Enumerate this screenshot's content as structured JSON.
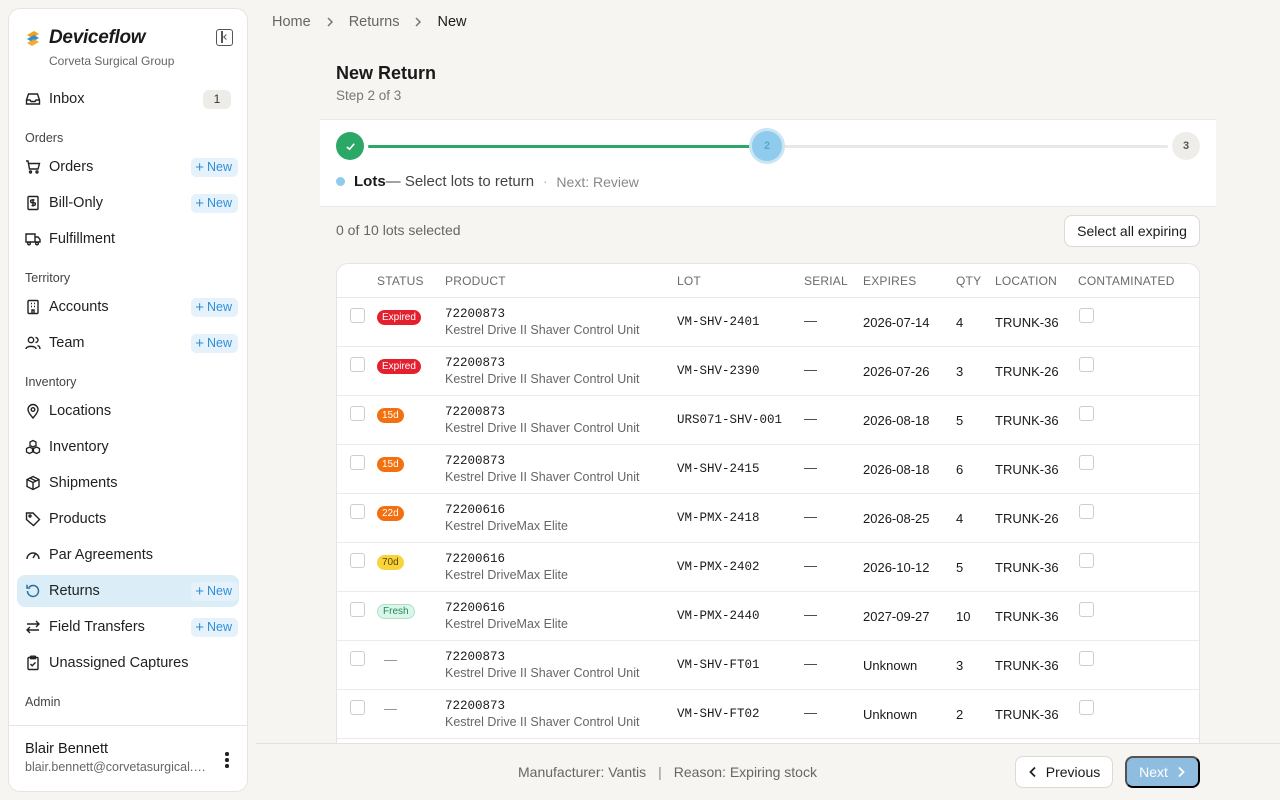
{
  "brand": {
    "name": "Deviceflow",
    "org": "Corveta Surgical Group"
  },
  "sidebar": {
    "inbox": {
      "label": "Inbox",
      "count": "1"
    },
    "sections": {
      "orders": "Orders",
      "territory": "Territory",
      "inventory": "Inventory",
      "admin": "Admin"
    },
    "items": {
      "orders": "Orders",
      "bill_only": "Bill-Only",
      "fulfillment": "Fulfillment",
      "accounts": "Accounts",
      "team": "Team",
      "locations": "Locations",
      "inventory": "Inventory",
      "shipments": "Shipments",
      "products": "Products",
      "par_agreements": "Par Agreements",
      "returns": "Returns",
      "field_transfers": "Field Transfers",
      "unassigned_captures": "Unassigned Captures"
    },
    "new_label": "New",
    "user": {
      "name": "Blair Bennett",
      "email": "blair.bennett@corvetasurgical.com"
    }
  },
  "breadcrumb": {
    "home": "Home",
    "returns": "Returns",
    "current": "New"
  },
  "header": {
    "title": "New Return",
    "subtitle": "Step 2 of 3"
  },
  "stepper": {
    "progress_fraction": 0.5,
    "steps": [
      "1",
      "2",
      "3"
    ],
    "current_label": "Lots",
    "current_desc": "— Select lots to return",
    "separator": "·",
    "next": "Next: Review"
  },
  "selection": {
    "count_text": "0 of 10 lots selected",
    "select_all_label": "Select all expiring"
  },
  "table": {
    "columns": {
      "status": "STATUS",
      "product": "PRODUCT",
      "lot": "LOT",
      "serial": "SERIAL",
      "expires": "EXPIRES",
      "qty": "QTY",
      "location": "LOCATION",
      "contaminated": "CONTAMINATED"
    },
    "rows": [
      {
        "status": "Expired",
        "status_kind": "expired",
        "code": "72200873",
        "name": "Kestrel Drive II Shaver Control Unit",
        "lot": "VM-SHV-2401",
        "serial": "—",
        "expires": "2026-07-14",
        "qty": "4",
        "location": "TRUNK-36"
      },
      {
        "status": "Expired",
        "status_kind": "expired",
        "code": "72200873",
        "name": "Kestrel Drive II Shaver Control Unit",
        "lot": "VM-SHV-2390",
        "serial": "—",
        "expires": "2026-07-26",
        "qty": "3",
        "location": "TRUNK-26"
      },
      {
        "status": "15d",
        "status_kind": "soon",
        "code": "72200873",
        "name": "Kestrel Drive II Shaver Control Unit",
        "lot": "URS071-SHV-001",
        "serial": "—",
        "expires": "2026-08-18",
        "qty": "5",
        "location": "TRUNK-36"
      },
      {
        "status": "15d",
        "status_kind": "soon",
        "code": "72200873",
        "name": "Kestrel Drive II Shaver Control Unit",
        "lot": "VM-SHV-2415",
        "serial": "—",
        "expires": "2026-08-18",
        "qty": "6",
        "location": "TRUNK-36"
      },
      {
        "status": "22d",
        "status_kind": "soon",
        "code": "72200616",
        "name": "Kestrel DriveMax Elite",
        "lot": "VM-PMX-2418",
        "serial": "—",
        "expires": "2026-08-25",
        "qty": "4",
        "location": "TRUNK-26"
      },
      {
        "status": "70d",
        "status_kind": "warn",
        "code": "72200616",
        "name": "Kestrel DriveMax Elite",
        "lot": "VM-PMX-2402",
        "serial": "—",
        "expires": "2026-10-12",
        "qty": "5",
        "location": "TRUNK-36"
      },
      {
        "status": "Fresh",
        "status_kind": "fresh",
        "code": "72200616",
        "name": "Kestrel DriveMax Elite",
        "lot": "VM-PMX-2440",
        "serial": "—",
        "expires": "2027-09-27",
        "qty": "10",
        "location": "TRUNK-36"
      },
      {
        "status": "—",
        "status_kind": "none",
        "code": "72200873",
        "name": "Kestrel Drive II Shaver Control Unit",
        "lot": "VM-SHV-FT01",
        "serial": "—",
        "expires": "Unknown",
        "qty": "3",
        "location": "TRUNK-36"
      },
      {
        "status": "—",
        "status_kind": "none",
        "code": "72200873",
        "name": "Kestrel Drive II Shaver Control Unit",
        "lot": "VM-SHV-FT02",
        "serial": "—",
        "expires": "Unknown",
        "qty": "2",
        "location": "TRUNK-36"
      }
    ]
  },
  "footer": {
    "manufacturer": "Manufacturer: Vantis",
    "divider": "|",
    "reason": "Reason: Expiring stock",
    "previous_label": "Previous",
    "next_label": "Next"
  },
  "colors": {
    "accent": "#2f8fd6",
    "active_nav_bg": "#dbeef8",
    "step_done": "#2ba866",
    "step_current": "#8ecbec",
    "expired": "#e5202e",
    "soon": "#f2700f",
    "warn": "#f8d43a",
    "fresh": "#1f8a55",
    "next_button": "#8fbde0"
  }
}
